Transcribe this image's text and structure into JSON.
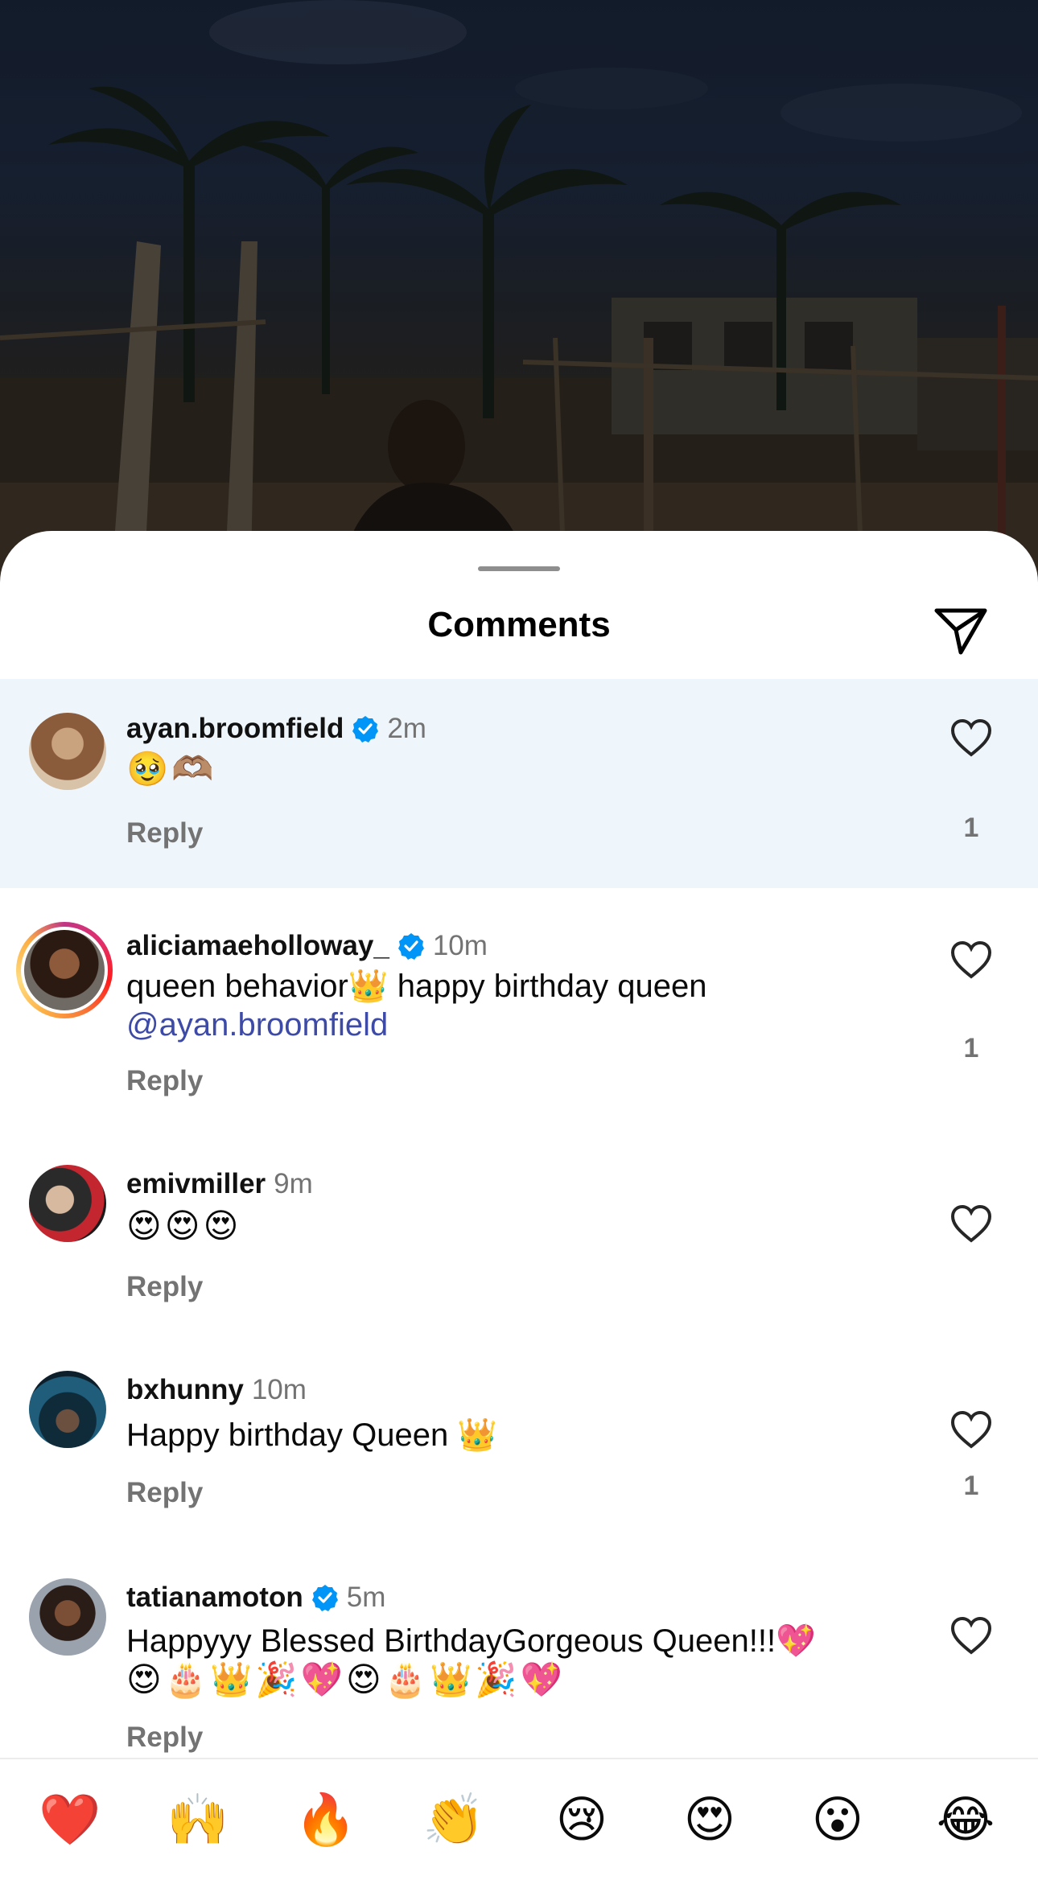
{
  "sheet": {
    "title": "Comments"
  },
  "comments": [
    {
      "username": "ayan.broomfield",
      "verified": true,
      "time": "2m",
      "text": "🥹🫶🏽",
      "reply_label": "Reply",
      "like_count": "1"
    },
    {
      "username": "aliciamaeholloway_",
      "verified": true,
      "time": "10m",
      "text_line1": "queen behavior👑 happy birthday queen",
      "mention": "@ayan.broomfield",
      "reply_label": "Reply",
      "like_count": "1"
    },
    {
      "username": "emivmiller",
      "verified": false,
      "time": "9m",
      "text": "😍😍😍",
      "reply_label": "Reply",
      "like_count": ""
    },
    {
      "username": "bxhunny",
      "verified": false,
      "time": "10m",
      "text": "Happy birthday Queen 👑",
      "reply_label": "Reply",
      "like_count": "1"
    },
    {
      "username": "tatianamoton",
      "verified": true,
      "time": "5m",
      "text_line1": "Happyyy Blessed BirthdayGorgeous Queen!!!💖",
      "text_line2": "😍🎂👑🎉💖😍🎂👑🎉💖",
      "reply_label": "Reply",
      "like_count": ""
    }
  ],
  "emoji_bar": [
    "❤️",
    "🙌",
    "🔥",
    "👏",
    "😢",
    "😍",
    "😮",
    "😂"
  ],
  "colors": {
    "verified": "#0095f6",
    "highlight": "#eef6fb",
    "mention": "#3d4aa6",
    "muted": "#737373"
  }
}
